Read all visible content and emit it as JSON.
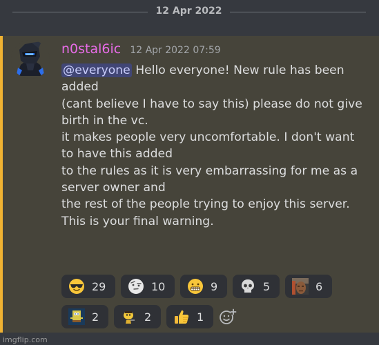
{
  "date_divider": {
    "label": "12 Apr 2022"
  },
  "message": {
    "username": "n0stal6ic",
    "timestamp": "12 Apr 2022 07:59",
    "mention": "@everyone",
    "lines": [
      "Hello everyone! New rule has been",
      "added",
      "(cant believe I have to say this) please do not give",
      "birth in the vc.",
      "it makes people very uncomfortable. I don't want",
      "to have this added",
      "to the rules as it is very embarrassing for me as a",
      "server owner and",
      "the rest of the people trying to enjoy this server.",
      "This is your final warning."
    ]
  },
  "reactions": [
    {
      "icon": "sunglasses-emoji-icon",
      "count": "29"
    },
    {
      "icon": "raised-eyebrow-emoji-icon",
      "count": "10"
    },
    {
      "icon": "grimacing-emoji-icon",
      "count": "9"
    },
    {
      "icon": "skull-emoji-icon",
      "count": "5"
    },
    {
      "icon": "custom-face-emoji-icon",
      "count": "6"
    },
    {
      "icon": "custom-sponge-emoji-icon",
      "count": "2"
    },
    {
      "icon": "custom-yellow-character-emoji-icon",
      "count": "2"
    },
    {
      "icon": "thumbs-up-emoji-icon",
      "count": "1"
    }
  ],
  "add_reaction": {
    "icon": "add-reaction-icon"
  },
  "watermark": "imgflip.com",
  "colors": {
    "background": "#36393f",
    "highlight": "#46443a",
    "accent_bar": "#f0b232",
    "username": "#e86ce8",
    "mention_bg": "#414675",
    "reaction_bg": "#2f3136"
  }
}
